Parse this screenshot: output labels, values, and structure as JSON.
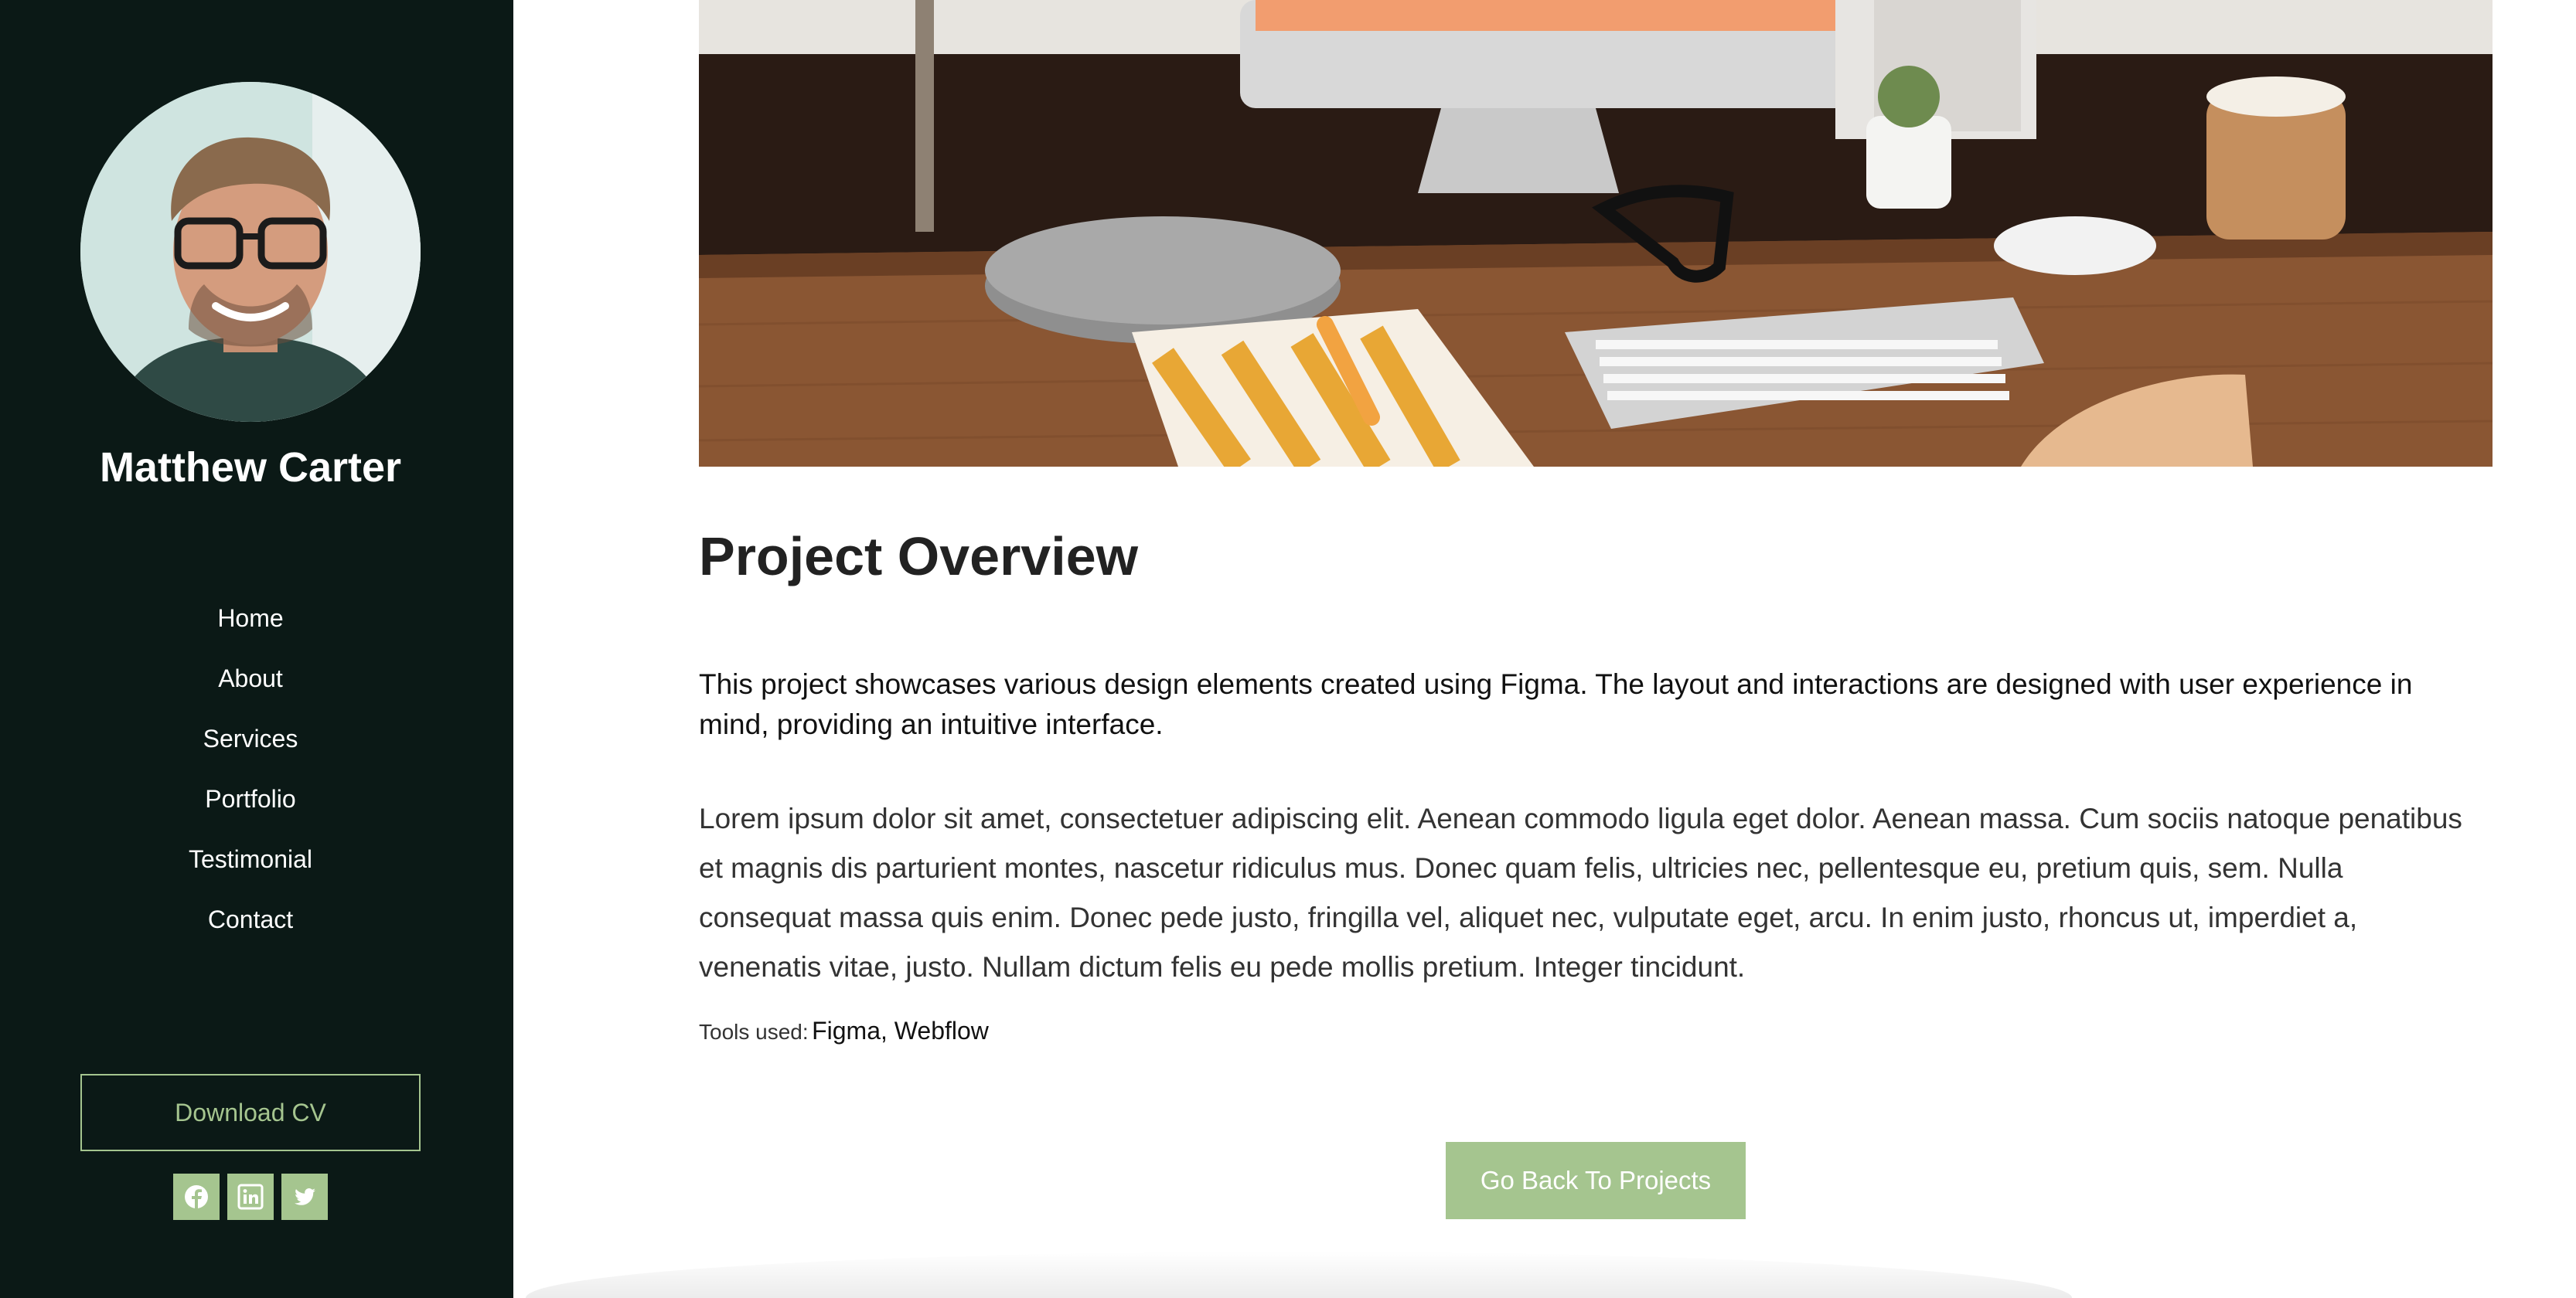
{
  "sidebar": {
    "name": "Matthew Carter",
    "nav": [
      "Home",
      "About",
      "Services",
      "Portfolio",
      "Testimonial",
      "Contact"
    ],
    "download_cv": "Download CV",
    "socials": [
      "facebook-icon",
      "linkedin-icon",
      "twitter-icon"
    ]
  },
  "main": {
    "title": "Project Overview",
    "intro": "This project showcases various design elements created using Figma. The layout and interactions are designed with user experience in mind, providing an intuitive interface.",
    "body": "Lorem ipsum dolor sit amet, consectetuer adipiscing elit. Aenean commodo ligula eget dolor. Aenean massa. Cum sociis natoque penatibus et magnis dis parturient montes, nascetur ridiculus mus. Donec quam felis, ultricies nec, pellentesque eu, pretium quis, sem. Nulla consequat massa quis enim. Donec pede justo, fringilla vel, aliquet nec, vulputate eget, arcu. In enim justo, rhoncus ut, imperdiet a, venenatis vitae, justo. Nullam dictum felis eu pede mollis pretium. Integer tincidunt.",
    "tools_label": "Tools used:",
    "tools_value": "Figma, Webflow",
    "back_button": "Go Back To Projects"
  },
  "colors": {
    "sidebar_bg": "#0b1916",
    "accent": "#a5c58f",
    "heading": "#222222"
  }
}
